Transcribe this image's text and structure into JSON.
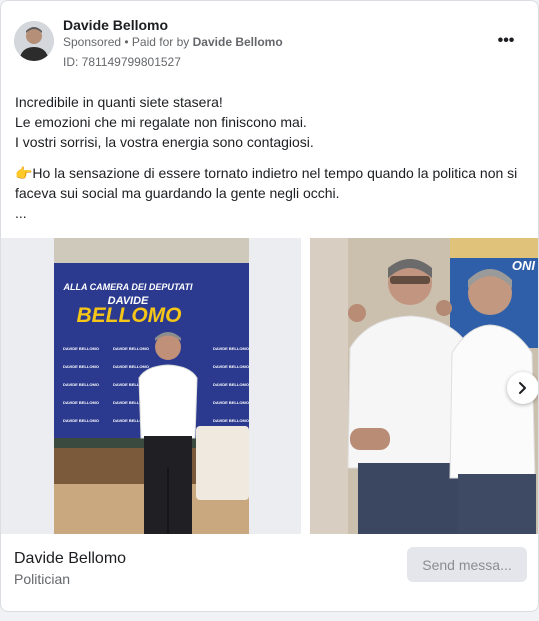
{
  "post": {
    "author": "Davide Bellomo",
    "sponsored_label": "Sponsored",
    "paid_for_prefix": "• Paid for by",
    "paid_for_name": "Davide Bellomo",
    "ad_id": "ID: 781149799801527",
    "more_label": "•••"
  },
  "body": {
    "lines": [
      "Incredibile in quanti siete stasera!",
      "Le emozioni che mi regalate non finiscono mai.",
      "I vostri sorrisi, la vostra energia sono contagiosi.",
      "",
      "👉Ho la sensazione di essere tornato indietro nel tempo quando la politica non si",
      "faceva sui social ma guardando la gente negli occhi.",
      "..."
    ]
  },
  "carousel": {
    "slide1_banner": {
      "line1": "ALLA CAMERA DEI DEPUTATI",
      "line2": "DAVIDE",
      "line3": "BELLOMO",
      "tile_text": "DAVIDE BELLOMO"
    },
    "slide2_banner": "ONI"
  },
  "footer": {
    "name": "Davide Bellomo",
    "category": "Politician",
    "send_button": "Send messa..."
  },
  "colors": {
    "banner_blue": "#2b3a8f",
    "banner_yellow": "#f5c518",
    "muted_text": "#65676b"
  }
}
